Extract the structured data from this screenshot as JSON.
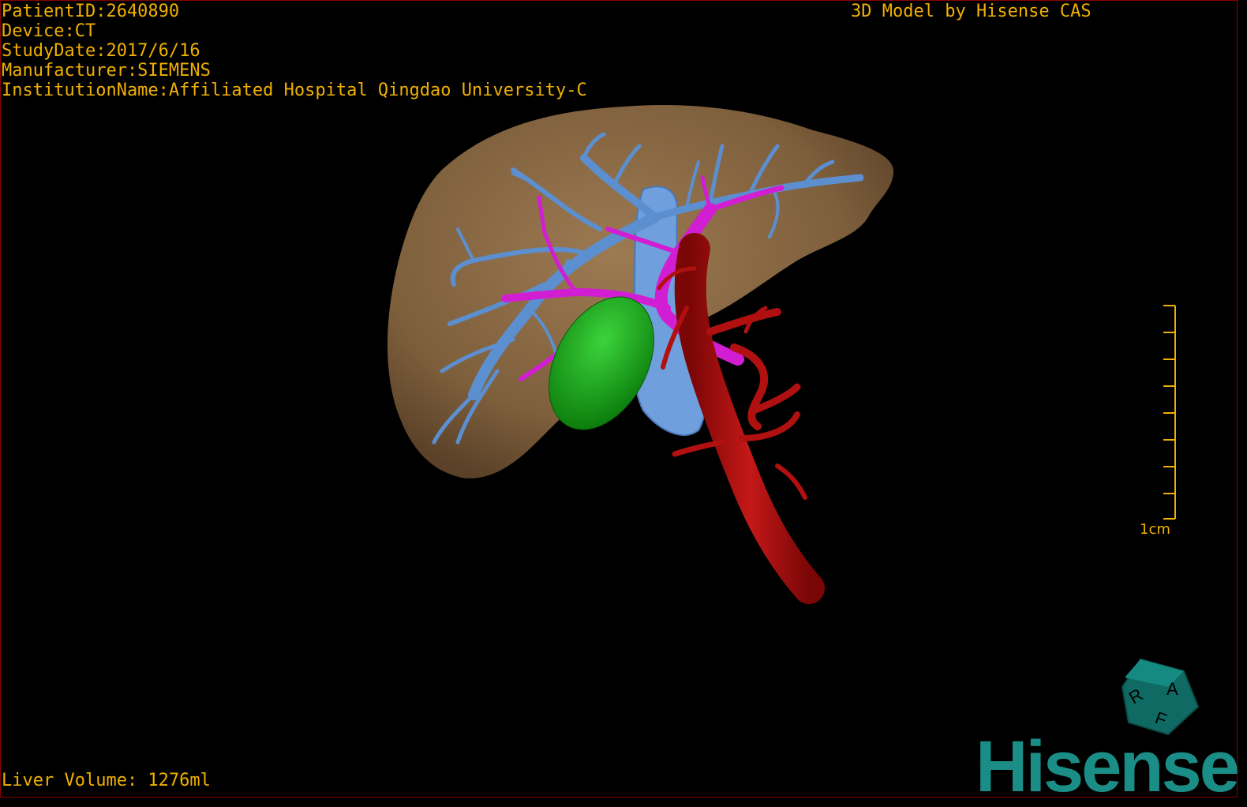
{
  "header": {
    "patient_id": "PatientID:2640890",
    "device": "Device:CT",
    "study_date": "StudyDate:2017/6/16",
    "manufacturer": "Manufacturer:SIEMENS",
    "institution": "InstitutionName:Affiliated Hospital Qingdao University-C"
  },
  "credit": "3D Model by Hisense CAS",
  "footer": {
    "liver_volume": "Liver Volume: 1276ml"
  },
  "scale_bar": {
    "label": "1cm"
  },
  "orientation_cube": {
    "labels": [
      "R",
      "A",
      "F"
    ],
    "icon": "orientation-cube-icon"
  },
  "brand": {
    "logo_text": "Hisense",
    "color": "#1a8e86"
  },
  "colors": {
    "overlay_text": "#f0b000",
    "liver": "#8c6a44",
    "hepatic_vein": "#5b8fd0",
    "portal_vein": "#d21ed2",
    "gallbladder": "#1ea01e",
    "artery_ivc": "#a80e0e",
    "background": "#000000"
  }
}
